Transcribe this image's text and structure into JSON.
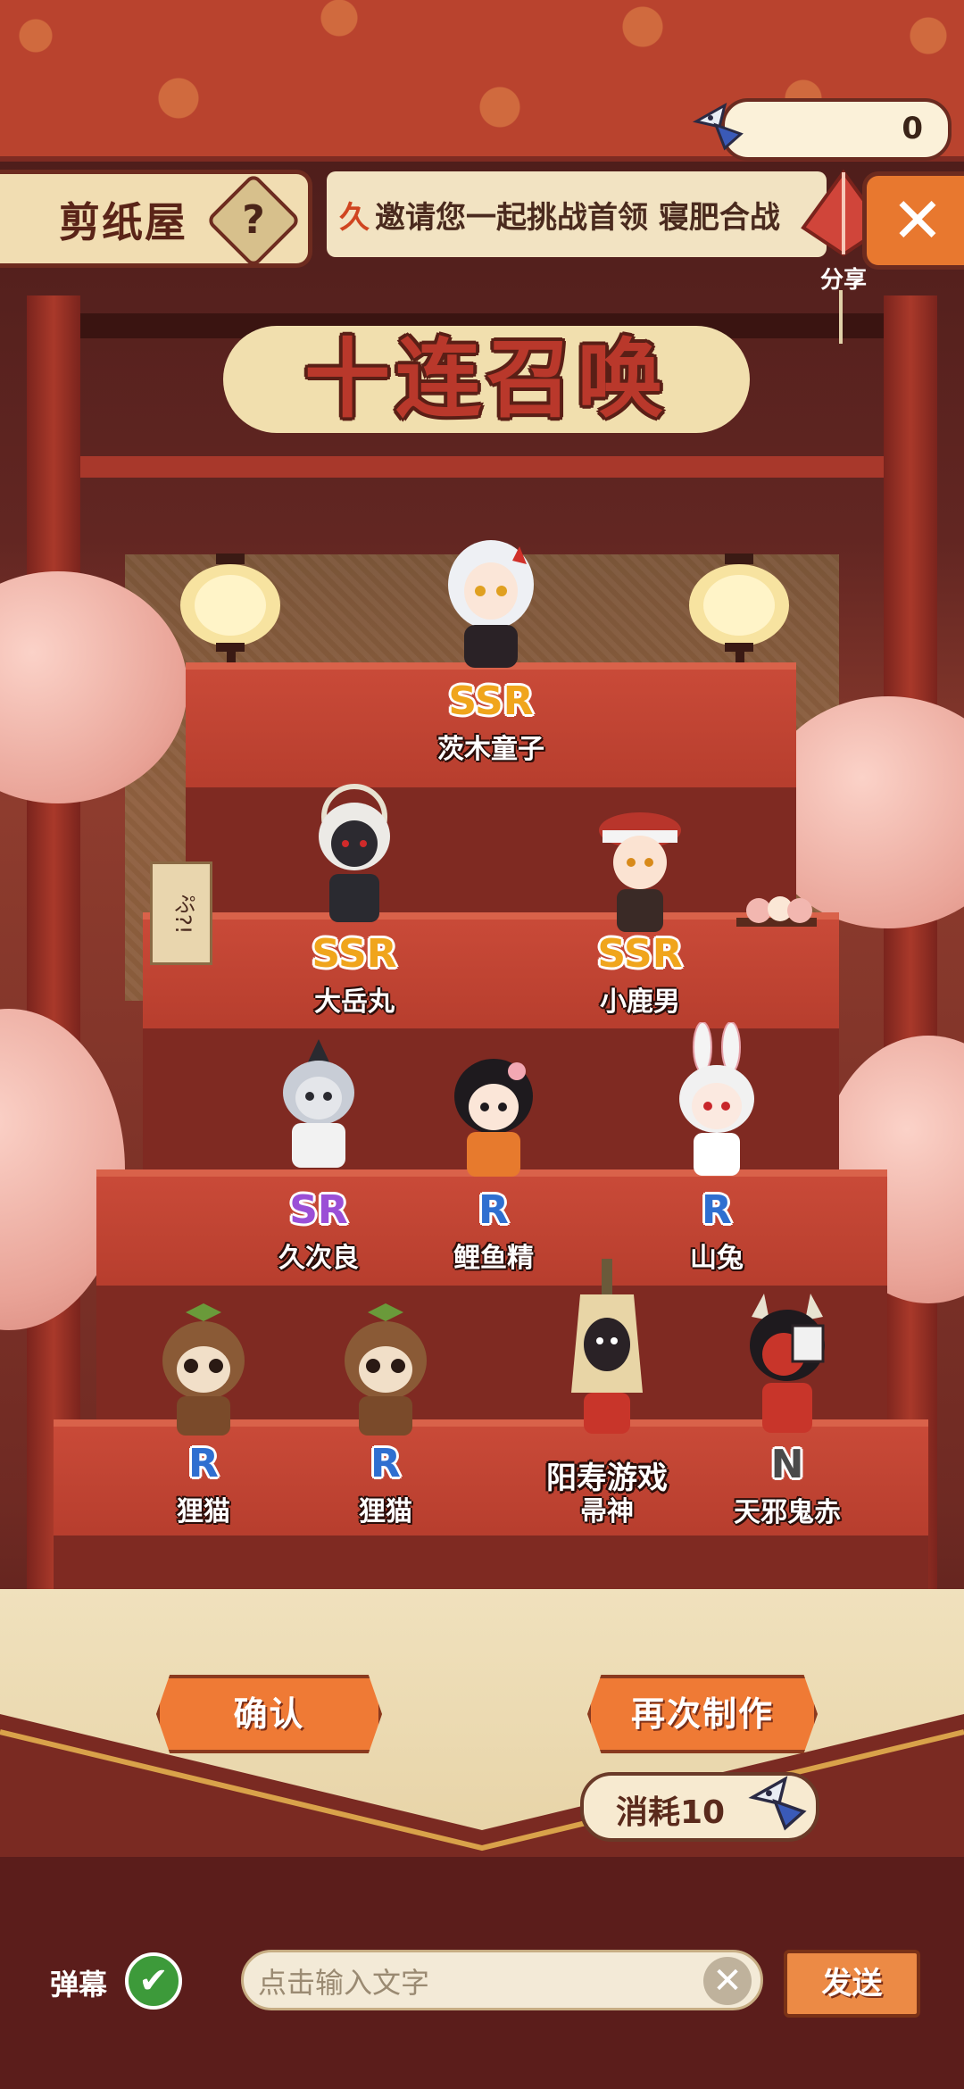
{
  "header": {
    "currency_count": "0",
    "house_title": "剪纸屋",
    "help_label": "?",
    "invite_text": "邀请您一起挑战首领 寝肥合战",
    "invite_mark": "久",
    "share_label": "分享",
    "close_label": "✕"
  },
  "title": "十连召唤",
  "decor": {
    "ticket_text": "ぷ?!"
  },
  "results": [
    {
      "rarity": "SSR",
      "name": "茨木童子",
      "rarity_color": "#f0a51c"
    },
    {
      "rarity": "SSR",
      "name": "大岳丸",
      "rarity_color": "#f0a51c"
    },
    {
      "rarity": "SSR",
      "name": "小鹿男",
      "rarity_color": "#f0a51c"
    },
    {
      "rarity": "SR",
      "name": "久次良",
      "rarity_color": "#9b4fd6"
    },
    {
      "rarity": "R",
      "name": "鲤鱼精",
      "rarity_color": "#2f6fd0"
    },
    {
      "rarity": "R",
      "name": "山兔",
      "rarity_color": "#2f6fd0"
    },
    {
      "rarity": "R",
      "name": "狸猫",
      "rarity_color": "#2f6fd0"
    },
    {
      "rarity": "R",
      "name": "狸猫",
      "rarity_color": "#2f6fd0"
    },
    {
      "rarity": "阳寿游戏",
      "name": "帚神",
      "rarity_color": "#ffffff"
    },
    {
      "rarity": "N",
      "name": "天邪鬼赤",
      "rarity_color": "#4a4a4a"
    }
  ],
  "actions": {
    "confirm_label": "确认",
    "remake_label": "再次制作",
    "cost_label": "消耗10"
  },
  "chat": {
    "danmaku_label": "弹幕",
    "check_icon": "✔",
    "input_placeholder": "点击输入文字",
    "clear_icon": "✕",
    "send_label": "发送"
  },
  "colors": {
    "accent_orange": "#ef7a35",
    "banner_red": "#b9432e",
    "cream": "#f1ddb2"
  }
}
